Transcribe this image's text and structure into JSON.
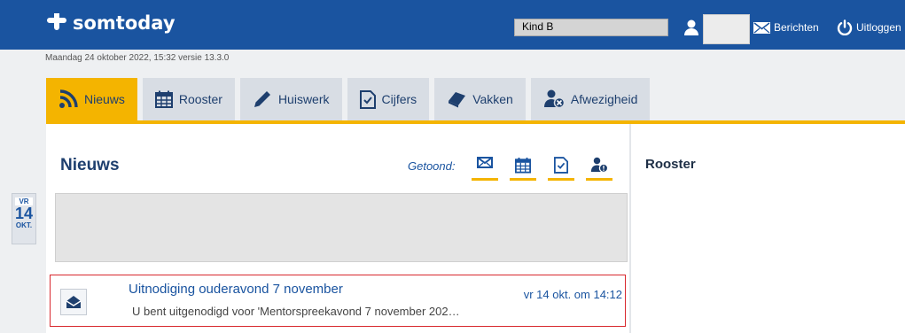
{
  "header": {
    "logo_text": "somtoday",
    "child_selector": "Kind B",
    "messages_label": "Berichten",
    "logout_label": "Uitloggen"
  },
  "datebar": "Maandag 24 oktober 2022, 15:32 versie 13.3.0",
  "tabs": [
    {
      "label": "Nieuws",
      "icon": "rss-icon",
      "active": true
    },
    {
      "label": "Rooster",
      "icon": "calendar-icon"
    },
    {
      "label": "Huiswerk",
      "icon": "pencil-icon"
    },
    {
      "label": "Cijfers",
      "icon": "checked-document-icon"
    },
    {
      "label": "Vakken",
      "icon": "books-icon"
    },
    {
      "label": "Afwezigheid",
      "icon": "absence-icon"
    }
  ],
  "news": {
    "title": "Nieuws",
    "shown_label": "Getoond:",
    "filters": [
      "envelope-icon",
      "calendar-icon",
      "checked-document-icon",
      "absence-icon"
    ],
    "items": [
      {
        "headline": "Uitnodiging ouderavond 7 november",
        "date": "vr 14 okt. om 14:12",
        "snippet": "U bent uitgenodigd voor 'Mentorspreekavond 7 november 202…",
        "icon": "open-envelope-icon"
      }
    ]
  },
  "date_badge": {
    "dow": "VR",
    "day": "14",
    "month": "OKT."
  },
  "rooster": {
    "title": "Rooster"
  },
  "colors": {
    "brand_blue": "#1a54a0",
    "accent_yellow": "#f4b400",
    "highlight_red": "#d8282e"
  }
}
